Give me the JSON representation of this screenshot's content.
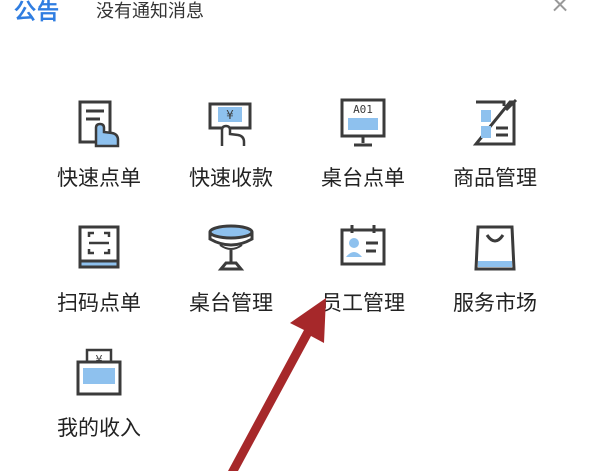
{
  "notice": {
    "tag": "公告",
    "text": "没有通知消息",
    "close_glyph": "×"
  },
  "menu": {
    "items": [
      {
        "label": "快速点单",
        "icon": "quick-order-icon"
      },
      {
        "label": "快速收款",
        "icon": "quick-payment-icon"
      },
      {
        "label": "桌台点单",
        "icon": "table-order-icon"
      },
      {
        "label": "商品管理",
        "icon": "product-management-icon"
      },
      {
        "label": "扫码点单",
        "icon": "scan-order-icon"
      },
      {
        "label": "桌台管理",
        "icon": "table-management-icon"
      },
      {
        "label": "员工管理",
        "icon": "staff-management-icon"
      },
      {
        "label": "服务市场",
        "icon": "service-market-icon"
      },
      {
        "label": "我的收入",
        "icon": "my-income-icon"
      }
    ]
  },
  "icon_text": {
    "yen": "¥",
    "table_code": "A01"
  },
  "colors": {
    "accent_blue": "#2f7de1",
    "icon_blue_fill": "#8ec1ee",
    "icon_stroke": "#3b3b3b",
    "arrow_red": "#a6282a"
  }
}
